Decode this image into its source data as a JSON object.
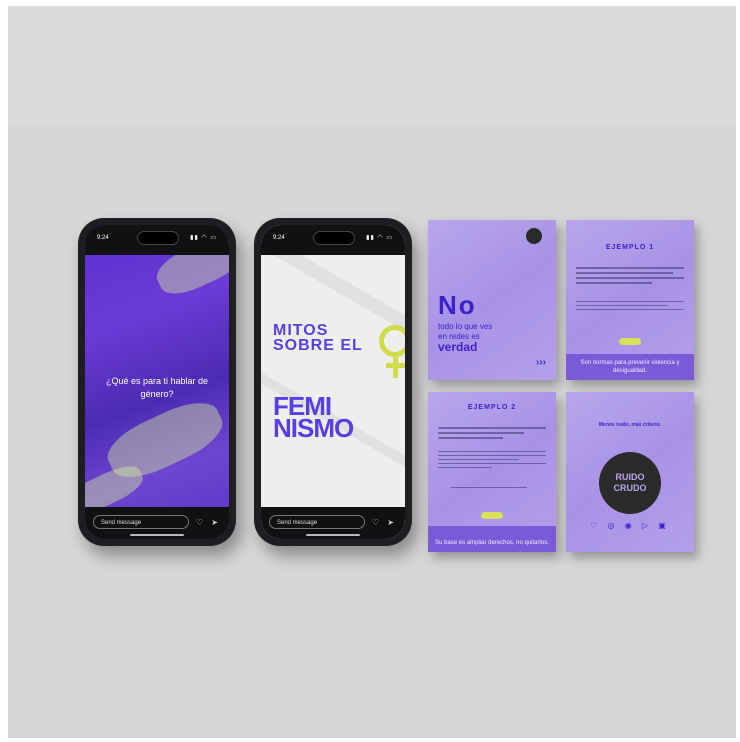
{
  "phone_left": {
    "time": "9:24",
    "question": "¿Qué es para ti hablar de género?",
    "message_placeholder": "Send message"
  },
  "phone_right": {
    "time": "9:24",
    "title": "MITOS SOBRE EL",
    "word_line1": "FEMI",
    "word_line2": "NISMO",
    "message_placeholder": "Send message"
  },
  "card_no": {
    "word": "No",
    "line1": "todo lo que ves",
    "line2": "en redes es",
    "line3": "verdad"
  },
  "card_ej1": {
    "title": "EJEMPLO 1",
    "footer": "Son normas para prevenir violencia y desigualdad."
  },
  "card_ej2": {
    "title": "EJEMPLO 2",
    "footer": "Su base es ampliar derechos, no quitarlos."
  },
  "card_logo": {
    "tagline": "Menos ruido, más criterio.",
    "logo_line1": "RUIDO",
    "logo_line2": "CRUDO"
  },
  "colors": {
    "purple_dark": "#3d22c9",
    "purple_card": "#b8a6ec",
    "accent_lime": "#d9e05a"
  }
}
